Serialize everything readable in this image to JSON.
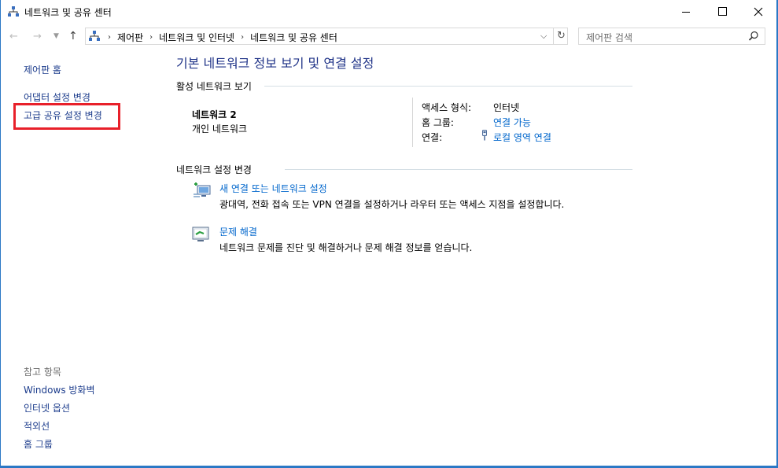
{
  "window": {
    "title": "네트워크 및 공유 센터"
  },
  "address_bar": {
    "crumbs": [
      "제어판",
      "네트워크 및 인터넷",
      "네트워크 및 공유 센터"
    ],
    "search_placeholder": "제어판 검색"
  },
  "left_panel": {
    "home": "제어판 홈",
    "adapter_settings": "어댑터 설정 변경",
    "advanced_sharing": "고급 공유 설정 변경",
    "see_also": "참고 항목",
    "see_also_items": [
      "Windows 방화벽",
      "인터넷 옵션",
      "적외선",
      "홈 그룹"
    ]
  },
  "main": {
    "title": "기본 네트워크 정보 보기 및 연결 설정",
    "active_networks_header": "활성 네트워크 보기",
    "network": {
      "name": "네트워크  2",
      "type": "개인 네트워크",
      "access_type_label": "액세스 형식:",
      "access_type_value": "인터넷",
      "homegroup_label": "홈 그룹:",
      "homegroup_value": "연결 가능",
      "connections_label": "연결:",
      "connections_value": "로컬 영역 연결"
    },
    "change_settings_header": "네트워크 설정 변경",
    "tasks": [
      {
        "title": "새 연결 또는 네트워크 설정",
        "desc": "광대역, 전화 접속 또는 VPN 연결을 설정하거나 라우터 또는 액세스 지점을 설정합니다.",
        "icon": "new-connection-icon"
      },
      {
        "title": "문제 해결",
        "desc": "네트워크 문제를 진단 및 해결하거나 문제 해결 정보를 얻습니다.",
        "icon": "troubleshoot-icon"
      }
    ]
  },
  "colors": {
    "link": "#0066cc",
    "title": "#1e3287",
    "highlight": "#e8202a",
    "window_border": "#2b78c5"
  }
}
